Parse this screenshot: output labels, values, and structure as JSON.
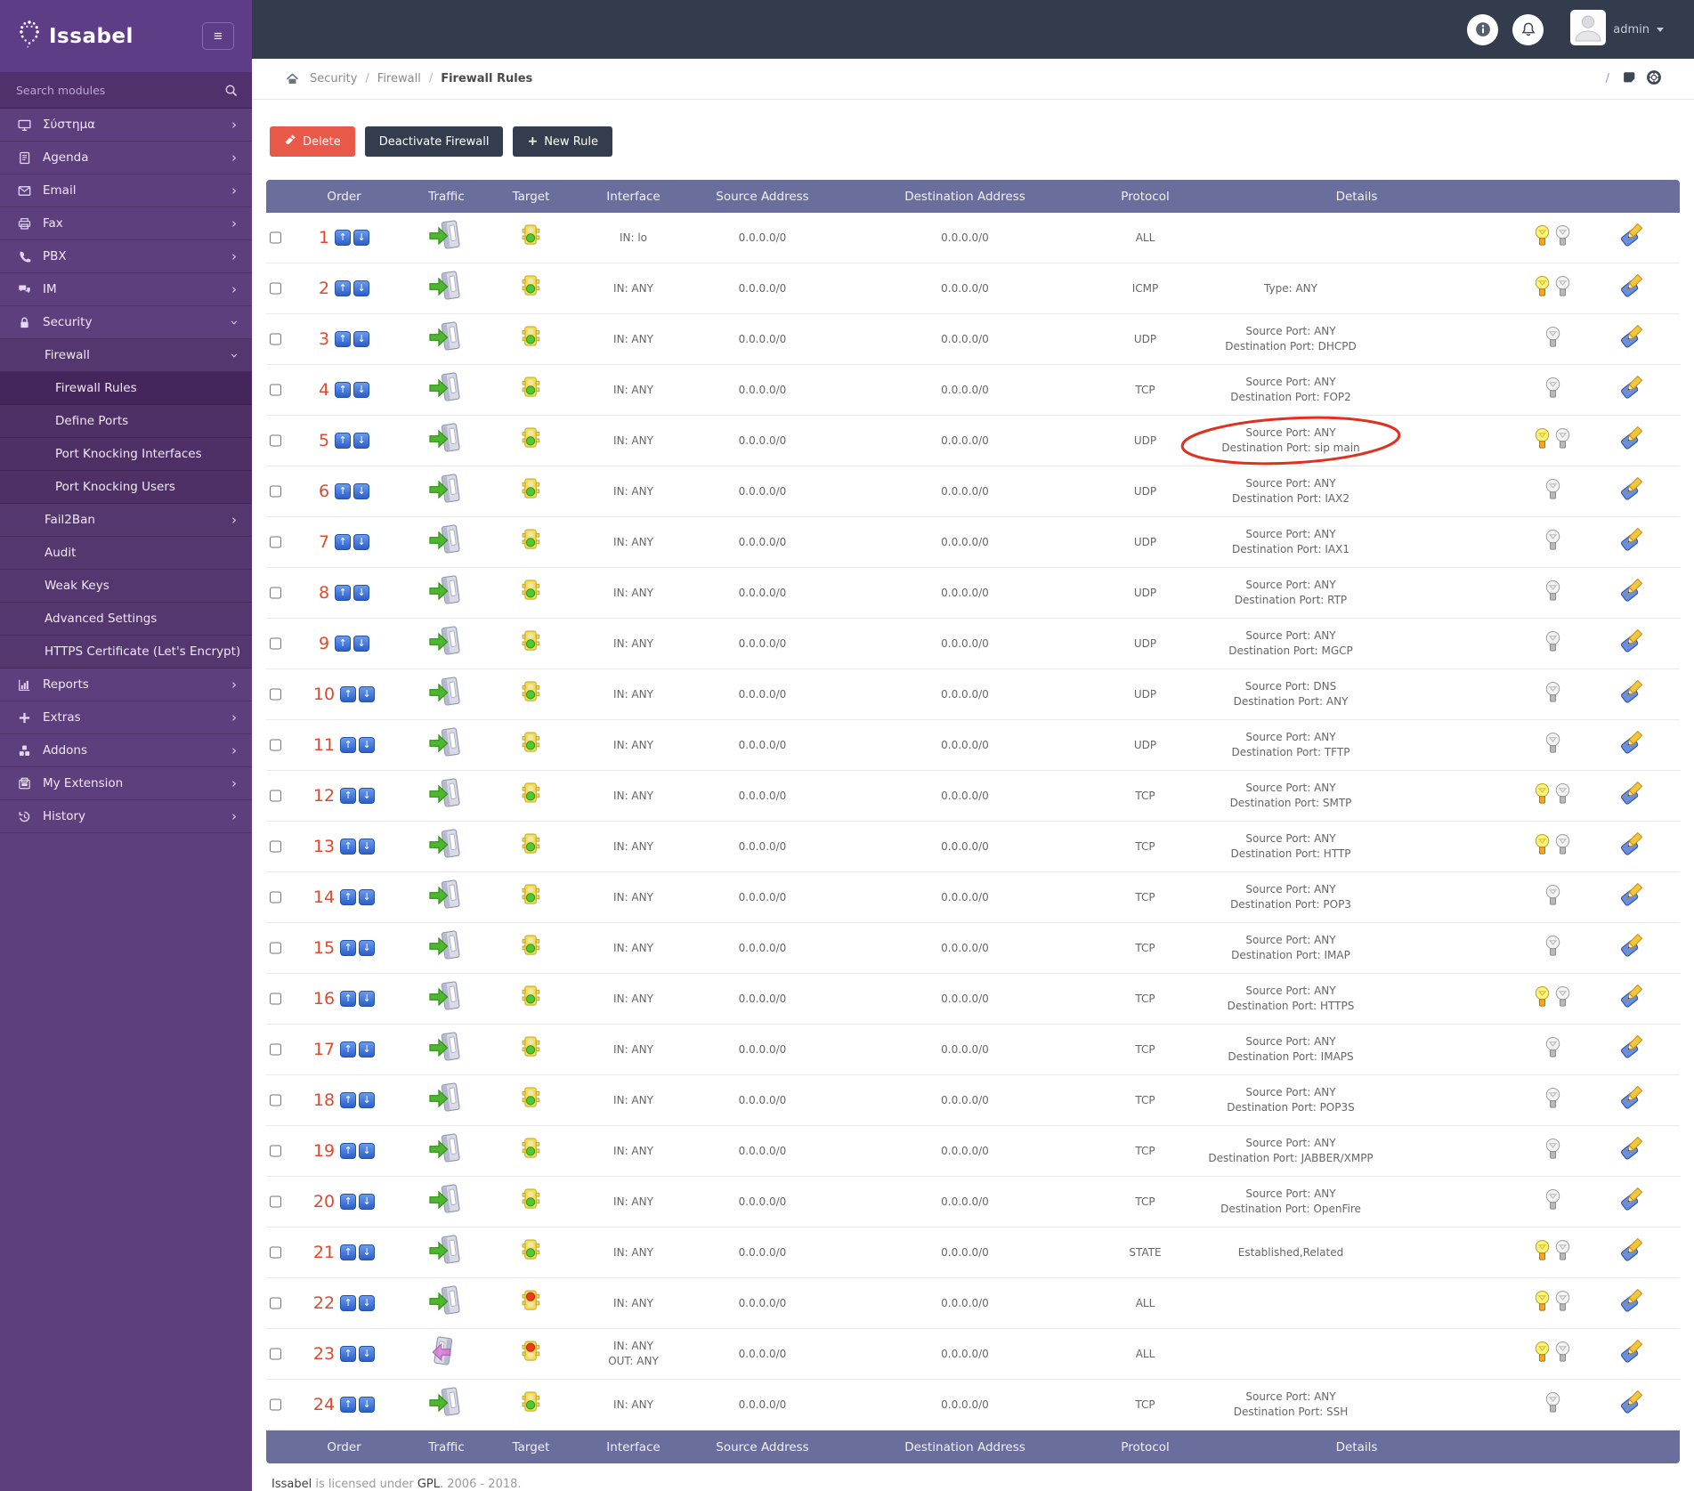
{
  "topbar": {
    "brand": "Issabel",
    "user": "admin"
  },
  "sidebar": {
    "search_placeholder": "Search modules",
    "items": [
      {
        "key": "system",
        "label": "Σύστημα",
        "icon": "monitor-icon",
        "level": 0,
        "chevron": "right",
        "active": false
      },
      {
        "key": "agenda",
        "label": "Agenda",
        "icon": "agenda-icon",
        "level": 0,
        "chevron": "right",
        "active": false
      },
      {
        "key": "email",
        "label": "Email",
        "icon": "email-icon",
        "level": 0,
        "chevron": "right",
        "active": false
      },
      {
        "key": "fax",
        "label": "Fax",
        "icon": "fax-icon",
        "level": 0,
        "chevron": "right",
        "active": false
      },
      {
        "key": "pbx",
        "label": "PBX",
        "icon": "phone-icon",
        "level": 0,
        "chevron": "right",
        "active": false
      },
      {
        "key": "im",
        "label": "IM",
        "icon": "chat-icon",
        "level": 0,
        "chevron": "right",
        "active": false
      },
      {
        "key": "security",
        "label": "Security",
        "icon": "lock-icon",
        "level": 0,
        "chevron": "down",
        "active": false
      },
      {
        "key": "firewall",
        "label": "Firewall",
        "icon": "",
        "level": 1,
        "chevron": "down",
        "active": false
      },
      {
        "key": "firewall-rules",
        "label": "Firewall Rules",
        "icon": "",
        "level": 2,
        "chevron": "",
        "active": true
      },
      {
        "key": "define-ports",
        "label": "Define Ports",
        "icon": "",
        "level": 2,
        "chevron": "",
        "active": false
      },
      {
        "key": "port-knocking-interfaces",
        "label": "Port Knocking Interfaces",
        "icon": "",
        "level": 2,
        "chevron": "",
        "active": false
      },
      {
        "key": "port-knocking-users",
        "label": "Port Knocking Users",
        "icon": "",
        "level": 2,
        "chevron": "",
        "active": false
      },
      {
        "key": "fail2ban",
        "label": "Fail2Ban",
        "icon": "",
        "level": 1,
        "chevron": "right",
        "active": false
      },
      {
        "key": "audit",
        "label": "Audit",
        "icon": "",
        "level": 1,
        "chevron": "",
        "active": false
      },
      {
        "key": "weak-keys",
        "label": "Weak Keys",
        "icon": "",
        "level": 1,
        "chevron": "",
        "active": false
      },
      {
        "key": "advanced-settings",
        "label": "Advanced Settings",
        "icon": "",
        "level": 1,
        "chevron": "",
        "active": false
      },
      {
        "key": "https-certificate",
        "label": "HTTPS Certificate (Let's Encrypt)",
        "icon": "",
        "level": 1,
        "chevron": "",
        "active": false
      },
      {
        "key": "reports",
        "label": "Reports",
        "icon": "reports-icon",
        "level": 0,
        "chevron": "right",
        "active": false
      },
      {
        "key": "extras",
        "label": "Extras",
        "icon": "plus-icon",
        "level": 0,
        "chevron": "right",
        "active": false
      },
      {
        "key": "addons",
        "label": "Addons",
        "icon": "addons-icon",
        "level": 0,
        "chevron": "right",
        "active": false
      },
      {
        "key": "my-extension",
        "label": "My Extension",
        "icon": "extension-icon",
        "level": 0,
        "chevron": "right",
        "active": false
      },
      {
        "key": "history",
        "label": "History",
        "icon": "history-icon",
        "level": 0,
        "chevron": "right",
        "active": false
      }
    ]
  },
  "breadcrumb": {
    "items": [
      "Security",
      "Firewall",
      "Firewall Rules"
    ],
    "separator": "/"
  },
  "toolbar": {
    "delete_label": "Delete",
    "deactivate_label": "Deactivate Firewall",
    "new_rule_label": "New Rule"
  },
  "colors": {
    "sidebar": "#5e3f7d",
    "topbar": "#323c4d",
    "table_header": "#696e9c",
    "delete_button": "#e9594a",
    "order_number": "#e0492f",
    "annotation": "#e0301e"
  },
  "table": {
    "headers": [
      "Order",
      "Traffic",
      "Target",
      "Interface",
      "Source Address",
      "Destination Address",
      "Protocol",
      "Details"
    ],
    "rows": [
      {
        "order": "1",
        "traffic": "in",
        "target": "accept",
        "iface1": "IN: lo",
        "iface2": "",
        "src": "0.0.0.0/0",
        "dst": "0.0.0.0/0",
        "proto": "ALL",
        "det1": "",
        "det2": "",
        "bulb": "on",
        "circled": false
      },
      {
        "order": "2",
        "traffic": "in",
        "target": "accept",
        "iface1": "IN: ANY",
        "iface2": "",
        "src": "0.0.0.0/0",
        "dst": "0.0.0.0/0",
        "proto": "ICMP",
        "det1": "Type: ANY",
        "det2": "",
        "bulb": "on",
        "circled": false
      },
      {
        "order": "3",
        "traffic": "in",
        "target": "accept",
        "iface1": "IN: ANY",
        "iface2": "",
        "src": "0.0.0.0/0",
        "dst": "0.0.0.0/0",
        "proto": "UDP",
        "det1": "Source Port: ANY",
        "det2": "Destination Port: DHCPD",
        "bulb": "off",
        "circled": false
      },
      {
        "order": "4",
        "traffic": "in",
        "target": "accept",
        "iface1": "IN: ANY",
        "iface2": "",
        "src": "0.0.0.0/0",
        "dst": "0.0.0.0/0",
        "proto": "TCP",
        "det1": "Source Port: ANY",
        "det2": "Destination Port: FOP2",
        "bulb": "off",
        "circled": false
      },
      {
        "order": "5",
        "traffic": "in",
        "target": "accept",
        "iface1": "IN: ANY",
        "iface2": "",
        "src": "0.0.0.0/0",
        "dst": "0.0.0.0/0",
        "proto": "UDP",
        "det1": "Source Port: ANY",
        "det2": "Destination Port: sip main",
        "bulb": "on",
        "circled": true
      },
      {
        "order": "6",
        "traffic": "in",
        "target": "accept",
        "iface1": "IN: ANY",
        "iface2": "",
        "src": "0.0.0.0/0",
        "dst": "0.0.0.0/0",
        "proto": "UDP",
        "det1": "Source Port: ANY",
        "det2": "Destination Port: IAX2",
        "bulb": "off",
        "circled": false
      },
      {
        "order": "7",
        "traffic": "in",
        "target": "accept",
        "iface1": "IN: ANY",
        "iface2": "",
        "src": "0.0.0.0/0",
        "dst": "0.0.0.0/0",
        "proto": "UDP",
        "det1": "Source Port: ANY",
        "det2": "Destination Port: IAX1",
        "bulb": "off",
        "circled": false
      },
      {
        "order": "8",
        "traffic": "in",
        "target": "accept",
        "iface1": "IN: ANY",
        "iface2": "",
        "src": "0.0.0.0/0",
        "dst": "0.0.0.0/0",
        "proto": "UDP",
        "det1": "Source Port: ANY",
        "det2": "Destination Port: RTP",
        "bulb": "off",
        "circled": false
      },
      {
        "order": "9",
        "traffic": "in",
        "target": "accept",
        "iface1": "IN: ANY",
        "iface2": "",
        "src": "0.0.0.0/0",
        "dst": "0.0.0.0/0",
        "proto": "UDP",
        "det1": "Source Port: ANY",
        "det2": "Destination Port: MGCP",
        "bulb": "off",
        "circled": false
      },
      {
        "order": "10",
        "traffic": "in",
        "target": "accept",
        "iface1": "IN: ANY",
        "iface2": "",
        "src": "0.0.0.0/0",
        "dst": "0.0.0.0/0",
        "proto": "UDP",
        "det1": "Source Port: DNS",
        "det2": "Destination Port: ANY",
        "bulb": "off",
        "circled": false
      },
      {
        "order": "11",
        "traffic": "in",
        "target": "accept",
        "iface1": "IN: ANY",
        "iface2": "",
        "src": "0.0.0.0/0",
        "dst": "0.0.0.0/0",
        "proto": "UDP",
        "det1": "Source Port: ANY",
        "det2": "Destination Port: TFTP",
        "bulb": "off",
        "circled": false
      },
      {
        "order": "12",
        "traffic": "in",
        "target": "accept",
        "iface1": "IN: ANY",
        "iface2": "",
        "src": "0.0.0.0/0",
        "dst": "0.0.0.0/0",
        "proto": "TCP",
        "det1": "Source Port: ANY",
        "det2": "Destination Port: SMTP",
        "bulb": "on",
        "circled": false
      },
      {
        "order": "13",
        "traffic": "in",
        "target": "accept",
        "iface1": "IN: ANY",
        "iface2": "",
        "src": "0.0.0.0/0",
        "dst": "0.0.0.0/0",
        "proto": "TCP",
        "det1": "Source Port: ANY",
        "det2": "Destination Port: HTTP",
        "bulb": "on",
        "circled": false
      },
      {
        "order": "14",
        "traffic": "in",
        "target": "accept",
        "iface1": "IN: ANY",
        "iface2": "",
        "src": "0.0.0.0/0",
        "dst": "0.0.0.0/0",
        "proto": "TCP",
        "det1": "Source Port: ANY",
        "det2": "Destination Port: POP3",
        "bulb": "off",
        "circled": false
      },
      {
        "order": "15",
        "traffic": "in",
        "target": "accept",
        "iface1": "IN: ANY",
        "iface2": "",
        "src": "0.0.0.0/0",
        "dst": "0.0.0.0/0",
        "proto": "TCP",
        "det1": "Source Port: ANY",
        "det2": "Destination Port: IMAP",
        "bulb": "off",
        "circled": false
      },
      {
        "order": "16",
        "traffic": "in",
        "target": "accept",
        "iface1": "IN: ANY",
        "iface2": "",
        "src": "0.0.0.0/0",
        "dst": "0.0.0.0/0",
        "proto": "TCP",
        "det1": "Source Port: ANY",
        "det2": "Destination Port: HTTPS",
        "bulb": "on",
        "circled": false
      },
      {
        "order": "17",
        "traffic": "in",
        "target": "accept",
        "iface1": "IN: ANY",
        "iface2": "",
        "src": "0.0.0.0/0",
        "dst": "0.0.0.0/0",
        "proto": "TCP",
        "det1": "Source Port: ANY",
        "det2": "Destination Port: IMAPS",
        "bulb": "off",
        "circled": false
      },
      {
        "order": "18",
        "traffic": "in",
        "target": "accept",
        "iface1": "IN: ANY",
        "iface2": "",
        "src": "0.0.0.0/0",
        "dst": "0.0.0.0/0",
        "proto": "TCP",
        "det1": "Source Port: ANY",
        "det2": "Destination Port: POP3S",
        "bulb": "off",
        "circled": false
      },
      {
        "order": "19",
        "traffic": "in",
        "target": "accept",
        "iface1": "IN: ANY",
        "iface2": "",
        "src": "0.0.0.0/0",
        "dst": "0.0.0.0/0",
        "proto": "TCP",
        "det1": "Source Port: ANY",
        "det2": "Destination Port: JABBER/XMPP",
        "bulb": "off",
        "circled": false
      },
      {
        "order": "20",
        "traffic": "in",
        "target": "accept",
        "iface1": "IN: ANY",
        "iface2": "",
        "src": "0.0.0.0/0",
        "dst": "0.0.0.0/0",
        "proto": "TCP",
        "det1": "Source Port: ANY",
        "det2": "Destination Port: OpenFire",
        "bulb": "off",
        "circled": false
      },
      {
        "order": "21",
        "traffic": "in",
        "target": "accept",
        "iface1": "IN: ANY",
        "iface2": "",
        "src": "0.0.0.0/0",
        "dst": "0.0.0.0/0",
        "proto": "STATE",
        "det1": "Established,Related",
        "det2": "",
        "bulb": "on",
        "circled": false
      },
      {
        "order": "22",
        "traffic": "in",
        "target": "drop",
        "iface1": "IN: ANY",
        "iface2": "",
        "src": "0.0.0.0/0",
        "dst": "0.0.0.0/0",
        "proto": "ALL",
        "det1": "",
        "det2": "",
        "bulb": "on",
        "circled": false
      },
      {
        "order": "23",
        "traffic": "out",
        "target": "drop",
        "iface1": "IN: ANY",
        "iface2": "OUT: ANY",
        "src": "0.0.0.0/0",
        "dst": "0.0.0.0/0",
        "proto": "ALL",
        "det1": "",
        "det2": "",
        "bulb": "on",
        "circled": false
      },
      {
        "order": "24",
        "traffic": "in",
        "target": "accept",
        "iface1": "IN: ANY",
        "iface2": "",
        "src": "0.0.0.0/0",
        "dst": "0.0.0.0/0",
        "proto": "TCP",
        "det1": "Source Port: ANY",
        "det2": "Destination Port: SSH",
        "bulb": "off",
        "circled": false
      }
    ]
  },
  "footer": {
    "brand": "Issabel",
    "mid": " is licensed under ",
    "license": "GPL",
    "tail": ". 2006 - 2018."
  }
}
